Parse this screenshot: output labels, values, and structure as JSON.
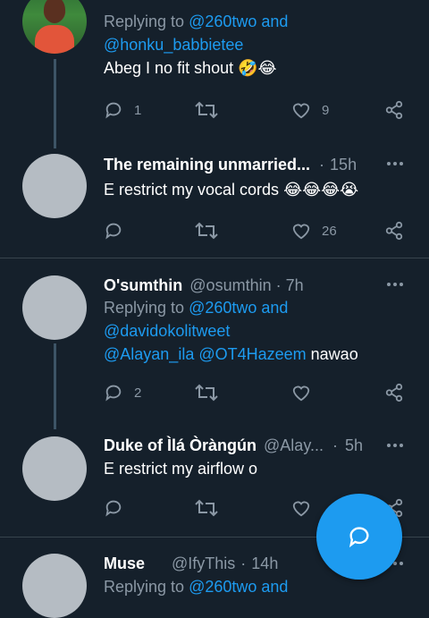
{
  "tweets": [
    {
      "reply_prefix": "Replying to",
      "mention1": "@260two and",
      "mention2": "@honku_babbietee",
      "text": "Abeg I no fit shout",
      "emojis": "🤣😂",
      "reply_count": "1",
      "like_count": "9"
    },
    {
      "name": "The remaining unmarried...",
      "dot": "·",
      "time": "15h",
      "text": "E restrict my vocal cords",
      "emojis": "😂😂😂😭",
      "reply_count": "",
      "like_count": "26"
    },
    {
      "name": "O'sumthin",
      "handle": "@osumthin",
      "dot": "·",
      "time": "7h",
      "reply_prefix": "Replying to",
      "mention1": "@260two and",
      "mention2": "@davidokolitweet",
      "mention3": "@Alayan_ila @OT4Hazeem",
      "text_after": "nawao",
      "reply_count": "2",
      "like_count": ""
    },
    {
      "name": "Duke of Ìlá Òràngún",
      "handle": "@Alay...",
      "dot": "·",
      "time": "5h",
      "text": "E restrict my airflow o"
    },
    {
      "name": "Muse",
      "handle": "@IfyThis",
      "dot": "·",
      "time": "14h",
      "reply_prefix": "Replying to",
      "mention1": "@260two and"
    }
  ],
  "icons": {
    "reply": "reply-icon",
    "retweet": "retweet-icon",
    "like": "heart-icon",
    "share": "share-icon",
    "more": "more-icon",
    "fab": "compose-reply-icon"
  },
  "colors": {
    "background": "#15202b",
    "accent": "#1d9bf0",
    "secondary_text": "#8b98a5",
    "divider": "#38444d"
  }
}
